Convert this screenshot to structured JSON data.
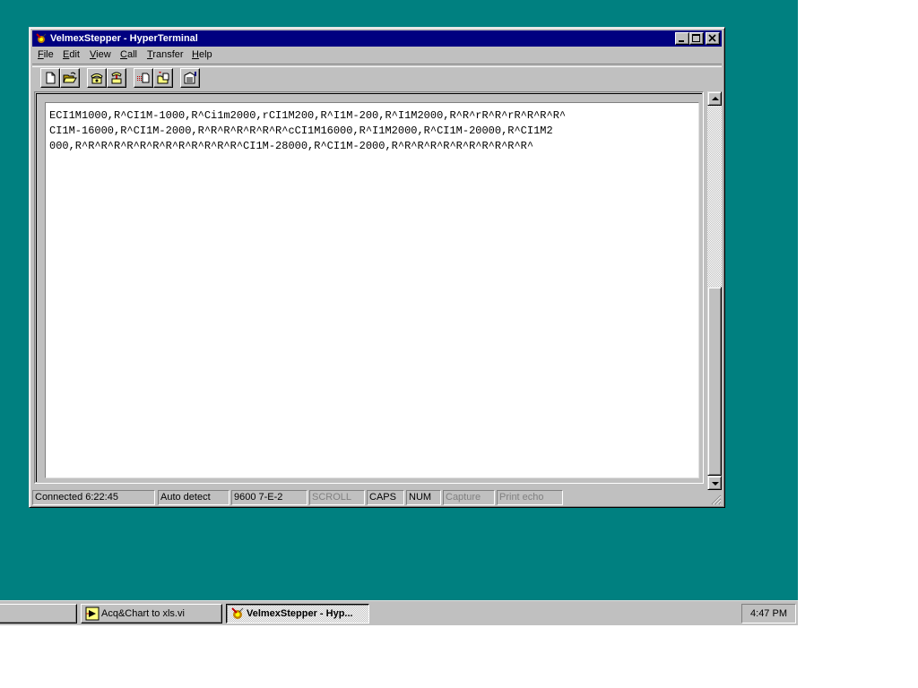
{
  "window": {
    "title": "VelmexStepper - HyperTerminal",
    "controls": {
      "minimize": "minimize",
      "maximize": "maximize",
      "close": "close"
    }
  },
  "menu": [
    {
      "label": "File",
      "accel": "F",
      "rest": "ile"
    },
    {
      "label": "Edit",
      "accel": "E",
      "rest": "dit"
    },
    {
      "label": "View",
      "accel": "V",
      "rest": "iew"
    },
    {
      "label": "Call",
      "accel": "C",
      "rest": "all"
    },
    {
      "label": "Transfer",
      "accel": "T",
      "rest": "ransfer"
    },
    {
      "label": "Help",
      "accel": "H",
      "rest": "elp"
    }
  ],
  "toolbar": [
    {
      "name": "new",
      "icon": "new-document-icon"
    },
    {
      "name": "open",
      "icon": "open-folder-icon"
    },
    {
      "name": "connect",
      "icon": "phone-icon"
    },
    {
      "name": "disconnect",
      "icon": "phone-hangup-icon"
    },
    {
      "name": "send",
      "icon": "send-file-icon"
    },
    {
      "name": "receive",
      "icon": "receive-file-icon"
    },
    {
      "name": "properties",
      "icon": "properties-icon"
    }
  ],
  "terminal": {
    "lines": [
      "ECI1M1000,R^CI1M-1000,R^Ci1m2000,rCI1M200,R^I1M-200,R^I1M2000,R^R^rR^R^rR^R^R^R^",
      "CI1M-16000,R^CI1M-2000,R^R^R^R^R^R^R^cCI1M16000,R^I1M2000,R^CI1M-20000,R^CI1M2",
      "000,R^R^R^R^R^R^R^R^R^R^R^R^R^CI1M-28000,R^CI1M-2000,R^R^R^R^R^R^R^R^R^R^R^"
    ],
    "scroll_position": 0.45
  },
  "status": {
    "connected": "Connected 6:22:45",
    "detect": "Auto detect",
    "settings": "9600 7-E-2",
    "scroll": "SCROLL",
    "caps": "CAPS",
    "num": "NUM",
    "capture": "Capture",
    "print_echo": "Print echo"
  },
  "taskbar": {
    "items": [
      {
        "label": "Acq&Chart to xls.vi",
        "icon": "labview-vi-icon",
        "active": false
      },
      {
        "label": "VelmexStepper - Hyp...",
        "icon": "hyperterminal-icon",
        "active": true
      }
    ],
    "clock": "4:47 PM"
  }
}
